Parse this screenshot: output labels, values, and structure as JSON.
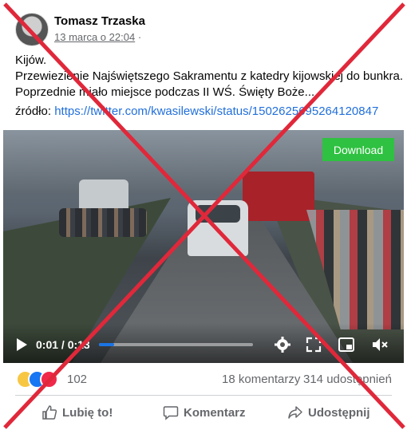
{
  "post": {
    "author": "Tomasz Trzaska",
    "date": "13 marca o 22:04",
    "privacy_separator": "·",
    "text_lines": [
      "Kijów.",
      "Przewiezienie Najświętszego Sakramentu z katedry kijowskiej do bunkra.",
      "Poprzednie miało miejsce podczas II WŚ. Święty Boże..."
    ],
    "source_label": "źródło:",
    "source_url": "https://twitter.com/kwasilewski/status/1502625695264120847"
  },
  "video": {
    "download_label": "Download",
    "time_readout": "0:01 / 0:13",
    "progress": 0.1,
    "icons": [
      "play-icon",
      "settings-icon",
      "fullscreen-icon",
      "picture-in-picture-icon",
      "volume-muted-icon"
    ]
  },
  "engagement": {
    "reaction_icons": [
      "sad-reaction-icon",
      "like-reaction-icon",
      "love-reaction-icon"
    ],
    "reaction_count": "102",
    "comments": "18 komentarzy",
    "shares": "314 udostępnień"
  },
  "actions": {
    "like": "Lubię to!",
    "comment": "Komentarz",
    "share": "Udostępnij"
  },
  "colors": {
    "link": "#216fdb",
    "download_button": "#2fc141",
    "progress": "#1b74e4",
    "cross": "#e0283a"
  }
}
